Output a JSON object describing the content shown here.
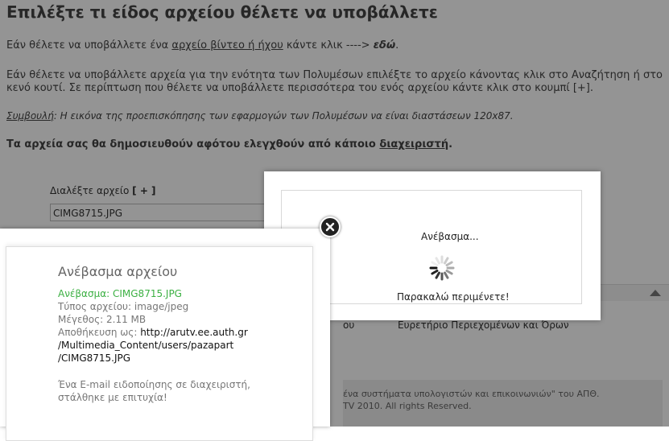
{
  "page": {
    "title": "Επιλέξτε τι είδος αρχείου θέλετε να υποβάλλετε",
    "p1_prefix": "Εάν θέλετε να υποβάλλετε ένα ",
    "p1_link": "αρχείο βίντεο ή ήχου",
    "p1_mid": " κάντε κλικ ----> ",
    "p1_here": "εδώ",
    "p1_end": ".",
    "p2": "Εάν θέλετε να υποβάλλετε αρχεία για την ενότητα των Πολυμέσων επιλέξτε το αρχείο κάνοντας κλικ στο Αναζήτηση ή στο κενό κουτί. Σε περίπτωση που θέλετε να υποβάλλετε περισσότερα του ενός αρχείου κάντε κλικ στο κουμπί [+].",
    "tip_label": "Συμβουλή",
    "tip_text": ": Η εικόνα της προεπισκόπησης των εφαρμογών των Πολυμέσων να είναι διαστάσεων 120x87.",
    "notice_prefix": "Τα αρχεία σας θα δημοσιευθούν αφότου ελεγχθούν από κάποιο ",
    "notice_link": "διαχειριστή",
    "notice_end": ".",
    "choose_label": "Διαλέξτε αρχείο ",
    "add_label": "[ + ]",
    "file_value": "CIMG8715.JPG"
  },
  "footer": {
    "left_fragment": "ου",
    "right_link": "Ευρετήριο Περιεχομένων και Όρων",
    "line1": "ένα συστήματα υπολογιστών και επικοινωνιών\" του ΑΠΘ.",
    "line2": "TV 2010. All rights Reserved."
  },
  "waiting_dialog": {
    "title": "Ανέβασμα...",
    "message": "Παρακαλώ περιμένετε!",
    "icon": "loading-spinner"
  },
  "result_dialog": {
    "title": "Ανέβασμα αρχείου",
    "uploaded_label": "Ανέβασμα: ",
    "uploaded_value": "CIMG8715.JPG",
    "type_label": "Τύπος αρχείου: ",
    "type_value": "image/jpeg",
    "size_label": "Μέγεθος: ",
    "size_value": "2.11 MB",
    "saved_label": "Αποθήκευση ως: ",
    "saved_line1": "http://arutv.ee.auth.gr",
    "saved_line2": "/Multimedia_Content/users/pazapart",
    "saved_line3": "/CIMG8715.JPG",
    "email_line1": "Ένα E-mail ειδοποίησης σε διαχειριστή,",
    "email_line2": "στάλθηκε με επιτυχία!",
    "close_icon": "close-icon"
  },
  "colors": {
    "overlay": "#000000",
    "success_green": "#3cb043",
    "close_button": "#222222"
  }
}
